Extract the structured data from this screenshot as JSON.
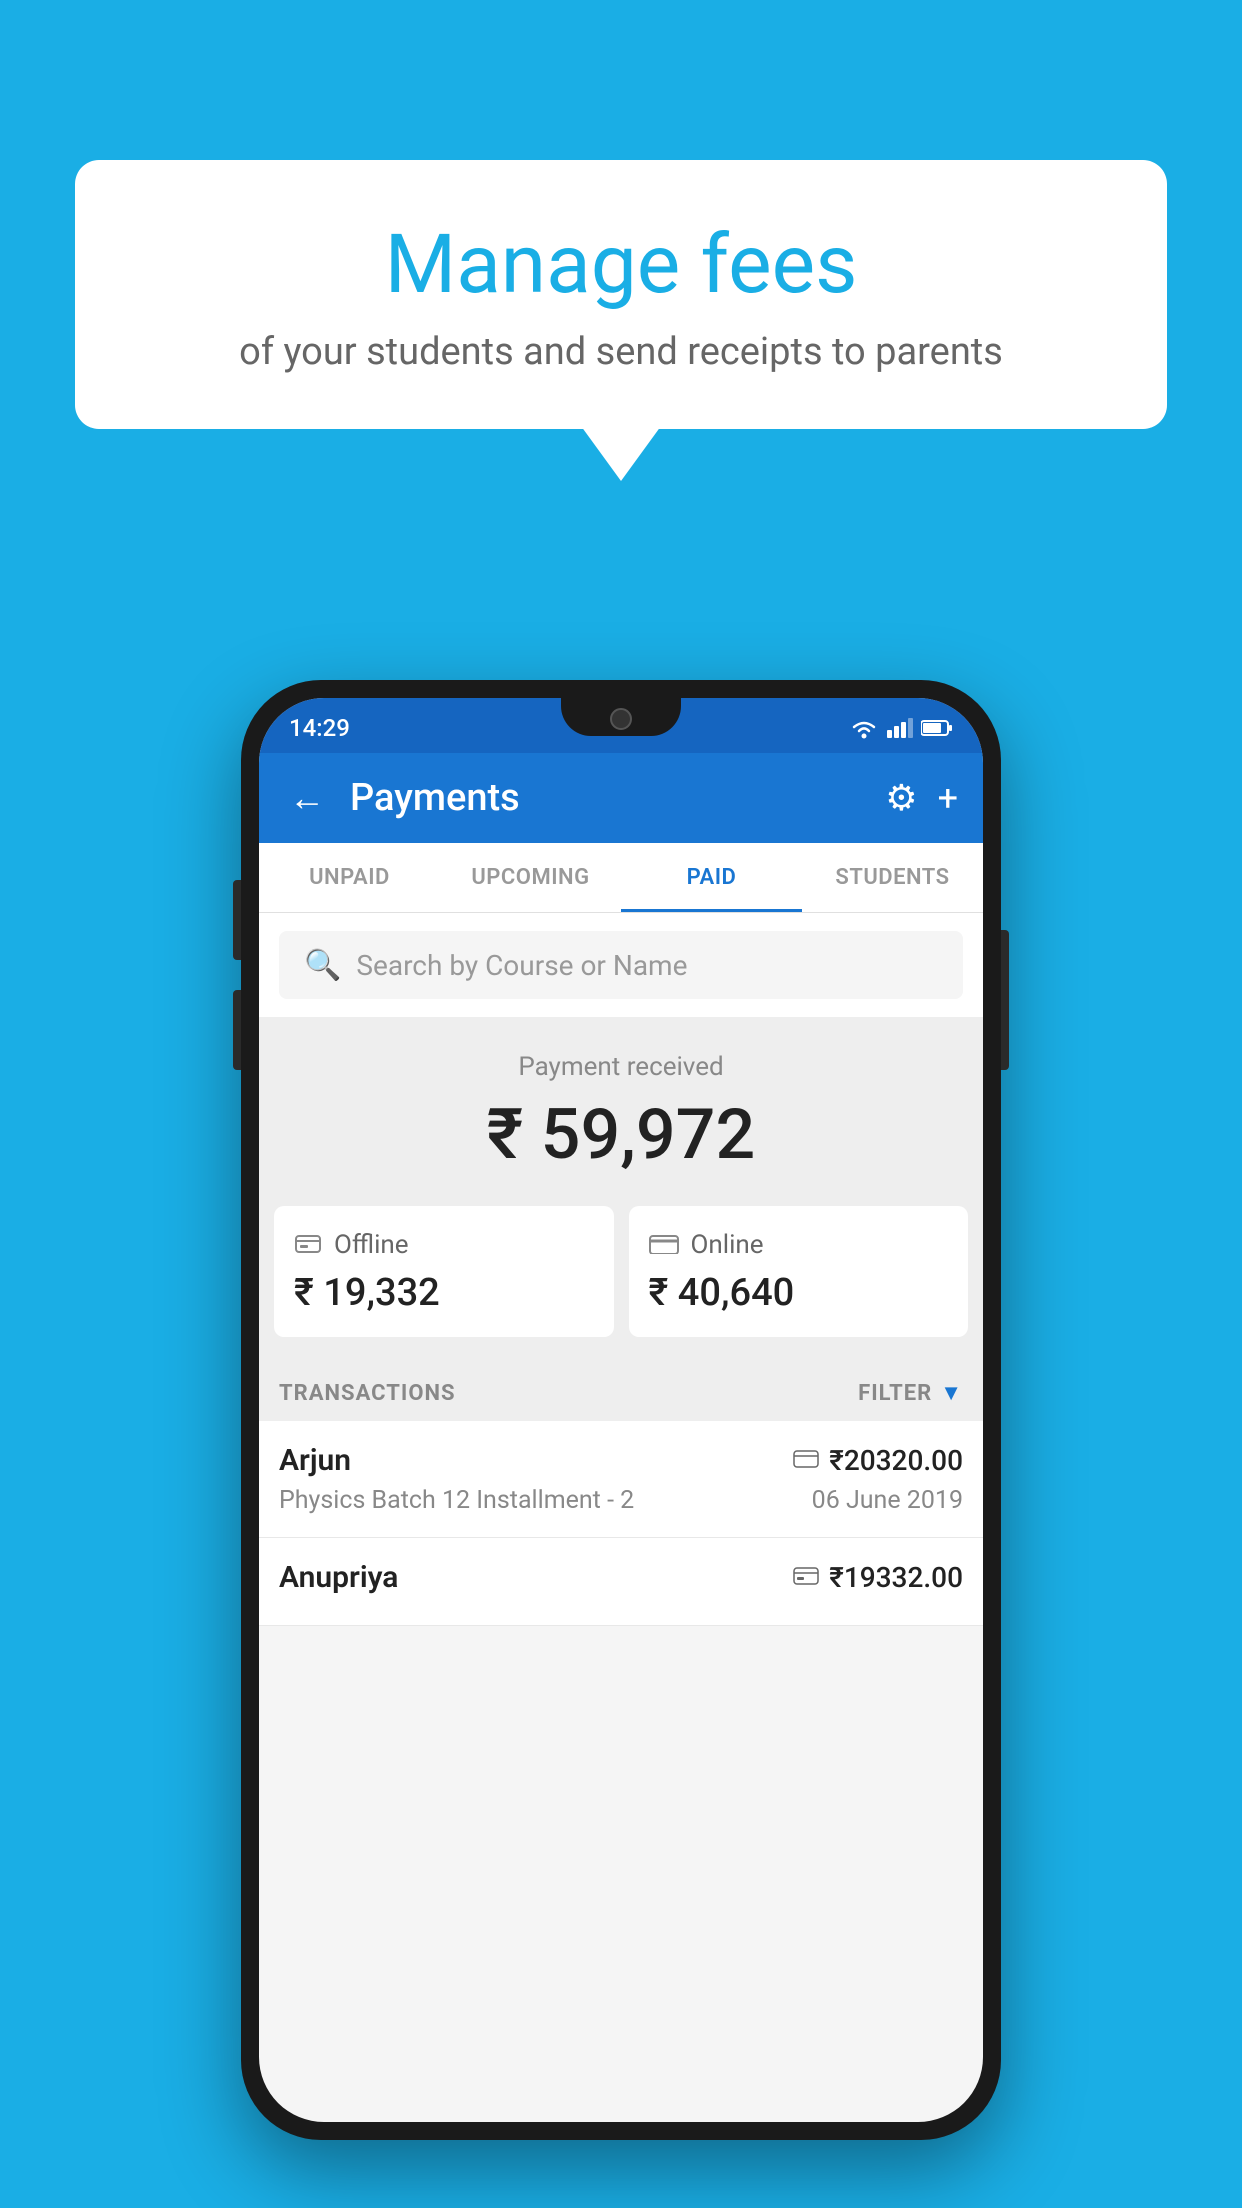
{
  "background_color": "#1aaee5",
  "bubble": {
    "title": "Manage fees",
    "subtitle": "of your students and send receipts to parents"
  },
  "status_bar": {
    "time": "14:29"
  },
  "app_bar": {
    "title": "Payments",
    "back_label": "←",
    "gear_label": "⚙",
    "plus_label": "+"
  },
  "tabs": [
    {
      "label": "UNPAID",
      "active": false
    },
    {
      "label": "UPCOMING",
      "active": false
    },
    {
      "label": "PAID",
      "active": true
    },
    {
      "label": "STUDENTS",
      "active": false
    }
  ],
  "search": {
    "placeholder": "Search by Course or Name"
  },
  "payment_received": {
    "label": "Payment received",
    "amount": "₹ 59,972"
  },
  "payment_cards": [
    {
      "type": "Offline",
      "amount": "₹ 19,332",
      "icon": "💳"
    },
    {
      "type": "Online",
      "amount": "₹ 40,640",
      "icon": "💳"
    }
  ],
  "transactions_header": {
    "label": "TRANSACTIONS",
    "filter_label": "FILTER"
  },
  "transactions": [
    {
      "name": "Arjun",
      "course": "Physics Batch 12 Installment - 2",
      "amount": "₹20320.00",
      "date": "06 June 2019",
      "payment_type": "card"
    },
    {
      "name": "Anupriya",
      "course": "",
      "amount": "₹19332.00",
      "date": "",
      "payment_type": "offline"
    }
  ]
}
